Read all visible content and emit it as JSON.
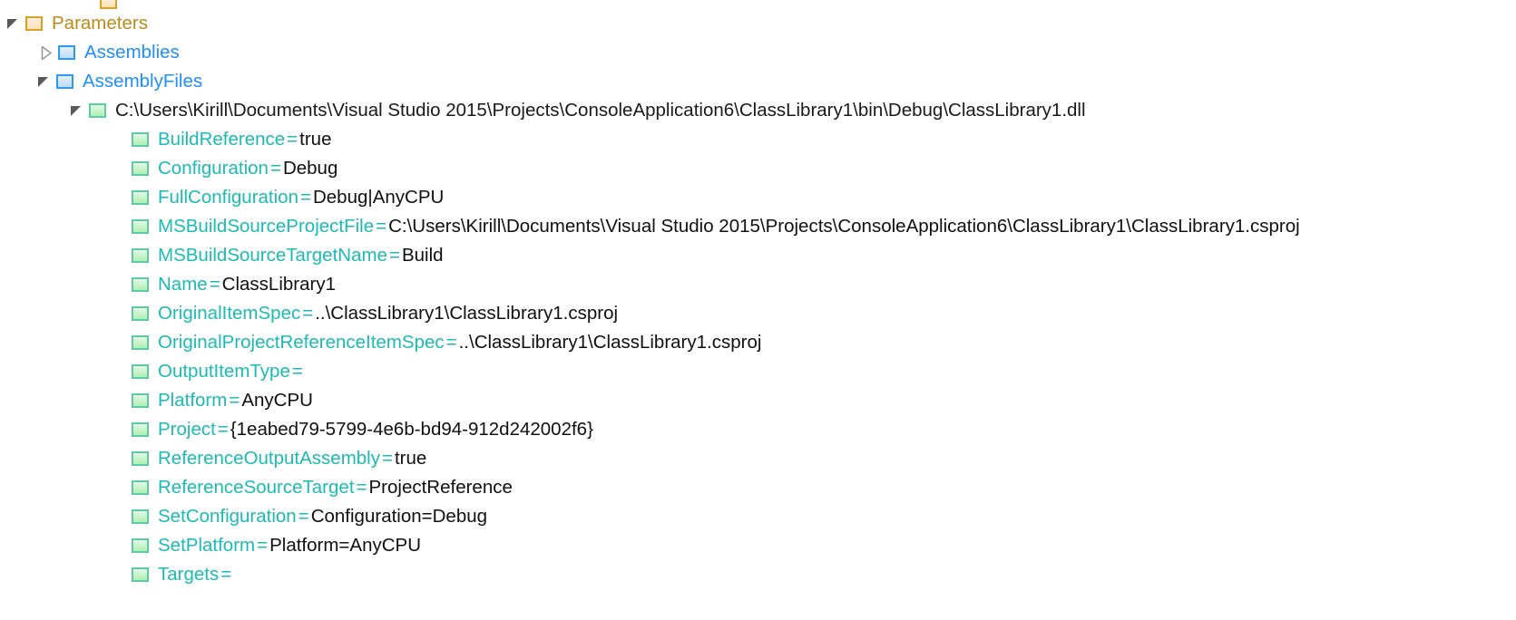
{
  "view": {
    "name": "msbuild-structured-log-tree",
    "background": "#ffffff",
    "colors": {
      "folder_border": "#D9A227",
      "folder_label": "#C08A17",
      "item_border": "#2E9BF0",
      "item_label": "#1E90FF",
      "metadata_border": "#61C9A3",
      "metadata_name": "#1BBCB4",
      "value_text": "#101010",
      "expander": "#595959"
    }
  },
  "tree": {
    "clipped_top_row": {
      "label": "",
      "icon": "folder-orange-icon"
    },
    "nodes": [
      {
        "id": "parameters",
        "label": "Parameters",
        "depth": 0,
        "expander": "expanded",
        "icon": "folder-orange-icon",
        "style": "orange"
      },
      {
        "id": "assemblies",
        "label": "Assemblies",
        "depth": 1,
        "expander": "collapsed",
        "icon": "item-blue-icon",
        "style": "blue"
      },
      {
        "id": "assembly-files",
        "label": "AssemblyFiles",
        "depth": 1,
        "expander": "expanded",
        "icon": "item-blue-icon",
        "style": "blue"
      },
      {
        "id": "class-library-dll",
        "label": "C:\\Users\\Kirill\\Documents\\Visual Studio 2015\\Projects\\ConsoleApplication6\\ClassLibrary1\\bin\\Debug\\ClassLibrary1.dll",
        "depth": 2,
        "expander": "expanded",
        "icon": "item-green-icon",
        "style": "black"
      }
    ],
    "metadata": [
      {
        "name": "BuildReference",
        "eq": "=",
        "value": "true"
      },
      {
        "name": "Configuration",
        "eq": "=",
        "value": "Debug"
      },
      {
        "name": "FullConfiguration",
        "eq": "=",
        "value": "Debug|AnyCPU"
      },
      {
        "name": "MSBuildSourceProjectFile",
        "eq": "=",
        "value": "C:\\Users\\Kirill\\Documents\\Visual Studio 2015\\Projects\\ConsoleApplication6\\ClassLibrary1\\ClassLibrary1.csproj"
      },
      {
        "name": "MSBuildSourceTargetName",
        "eq": "=",
        "value": "Build"
      },
      {
        "name": "Name",
        "eq": "=",
        "value": "ClassLibrary1"
      },
      {
        "name": "OriginalItemSpec",
        "eq": "=",
        "value": "..\\ClassLibrary1\\ClassLibrary1.csproj"
      },
      {
        "name": "OriginalProjectReferenceItemSpec",
        "eq": "=",
        "value": "..\\ClassLibrary1\\ClassLibrary1.csproj"
      },
      {
        "name": "OutputItemType",
        "eq": "=",
        "value": ""
      },
      {
        "name": "Platform",
        "eq": "=",
        "value": "AnyCPU"
      },
      {
        "name": "Project",
        "eq": "=",
        "value": "{1eabed79-5799-4e6b-bd94-912d242002f6}"
      },
      {
        "name": "ReferenceOutputAssembly",
        "eq": "=",
        "value": "true"
      },
      {
        "name": "ReferenceSourceTarget",
        "eq": "=",
        "value": "ProjectReference"
      },
      {
        "name": "SetConfiguration",
        "eq": "=",
        "value": "Configuration=Debug"
      },
      {
        "name": "SetPlatform",
        "eq": "=",
        "value": "Platform=AnyCPU"
      },
      {
        "name": "Targets",
        "eq": "=",
        "value": ""
      }
    ]
  }
}
